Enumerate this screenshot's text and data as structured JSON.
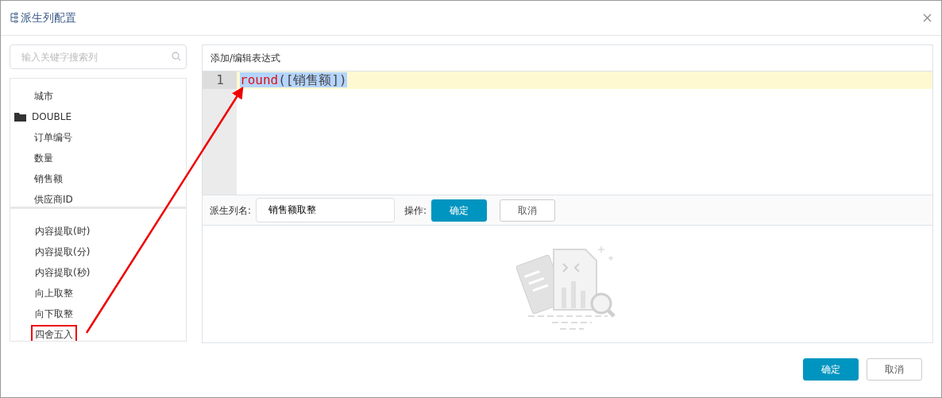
{
  "window": {
    "title": "派生列配置"
  },
  "search": {
    "placeholder": "输入关键字搜索列"
  },
  "columns": [
    {
      "label": "城市",
      "kind": "column"
    },
    {
      "label": "DOUBLE",
      "kind": "folder",
      "children": [
        {
          "label": "订单编号",
          "kind": "column"
        },
        {
          "label": "数量",
          "kind": "column"
        },
        {
          "label": "销售额",
          "kind": "column"
        },
        {
          "label": "供应商ID",
          "kind": "column"
        }
      ]
    }
  ],
  "functions": [
    {
      "label": "内容提取(时)",
      "highlighted": false
    },
    {
      "label": "内容提取(分)",
      "highlighted": false
    },
    {
      "label": "内容提取(秒)",
      "highlighted": false
    },
    {
      "label": "向上取整",
      "highlighted": false
    },
    {
      "label": "向下取整",
      "highlighted": false
    },
    {
      "label": "四舍五入",
      "highlighted": true
    }
  ],
  "editor": {
    "title": "添加/编辑表达式",
    "lines": [
      {
        "number": "1",
        "selected": true,
        "tokens": [
          {
            "text": "round",
            "kind": "function"
          },
          {
            "text": "([销售额])",
            "kind": "plain"
          }
        ]
      }
    ]
  },
  "name_row": {
    "label": "派生列名:",
    "value": "销售额取整",
    "actions_label": "操作:",
    "buttons": [
      {
        "label": "确定",
        "kind": "primary"
      },
      {
        "label": "取消",
        "kind": "secondary"
      }
    ]
  },
  "annotation": {
    "arrow": true
  },
  "footer": {
    "buttons": [
      {
        "label": "确定",
        "kind": "primary"
      },
      {
        "label": "取消",
        "kind": "secondary"
      }
    ]
  }
}
